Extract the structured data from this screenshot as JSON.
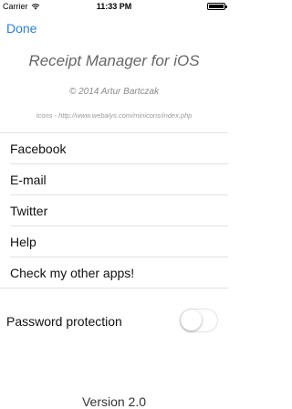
{
  "status_bar": {
    "carrier": "Carrier",
    "time": "11:33 PM"
  },
  "nav": {
    "done_label": "Done",
    "accent_color": "#2a7de1"
  },
  "header": {
    "title": "Receipt Manager for iOS",
    "copyright": "© 2014 Artur Bartczak",
    "icons_credit": "Icons - http://www.webalys.com/minicons/index.php"
  },
  "menu": {
    "items": [
      {
        "label": "Facebook"
      },
      {
        "label": "E-mail"
      },
      {
        "label": "Twitter"
      },
      {
        "label": "Help"
      },
      {
        "label": "Check my other apps!"
      }
    ]
  },
  "settings": {
    "password_label": "Password protection",
    "password_enabled": false
  },
  "footer": {
    "version": "Version 2.0"
  }
}
